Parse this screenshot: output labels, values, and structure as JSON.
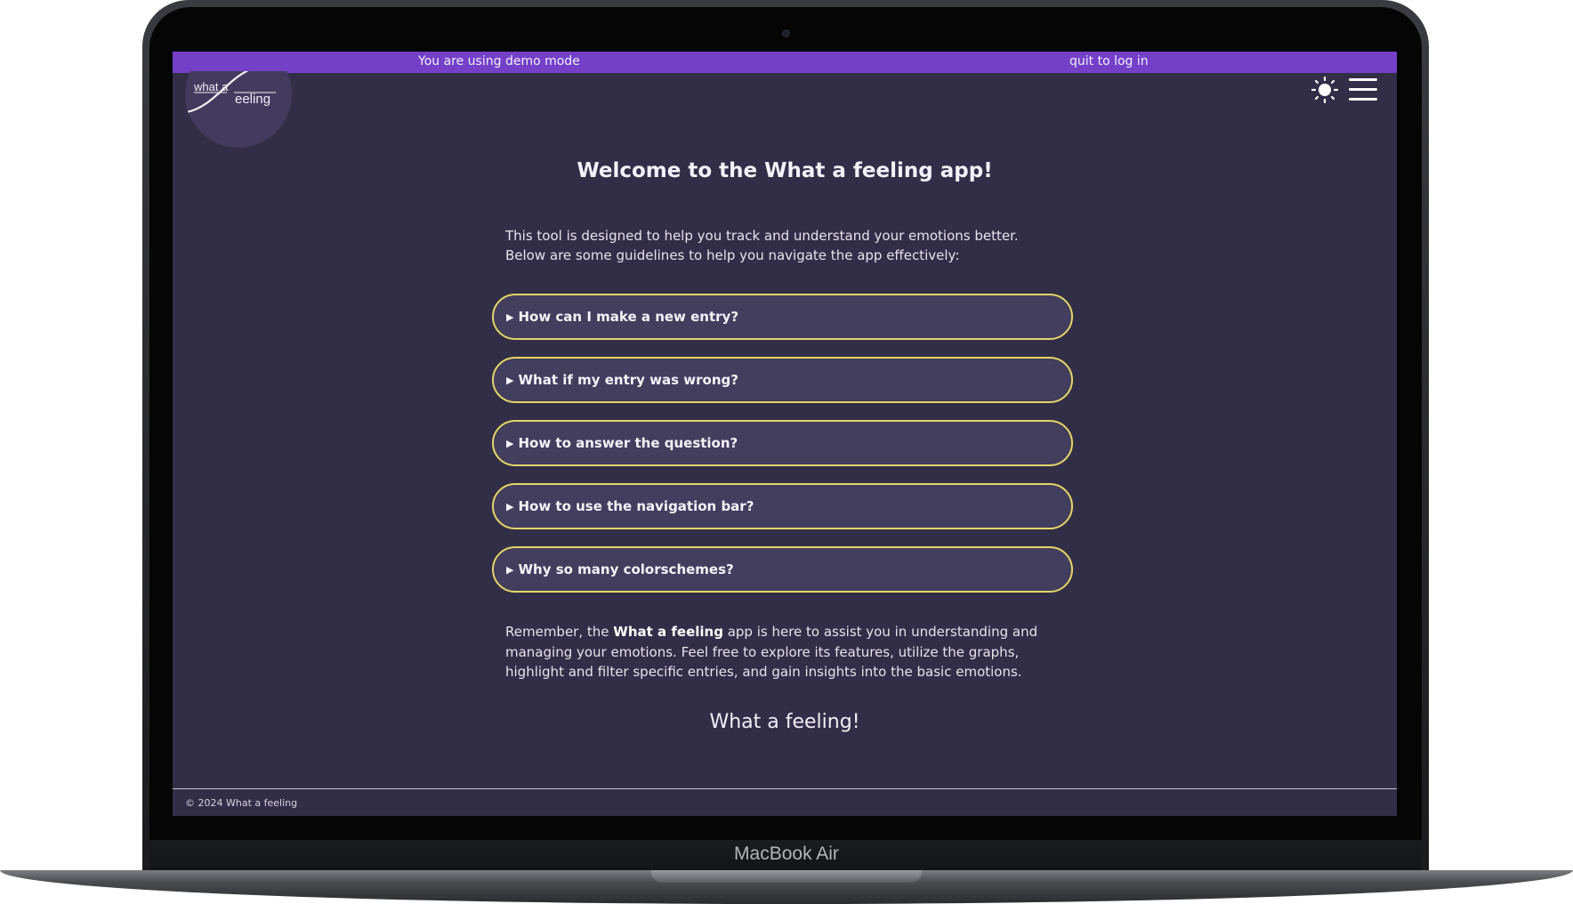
{
  "device": {
    "model_label": "MacBook Air"
  },
  "banner": {
    "demo_text": "You are using demo mode",
    "quit_label": "quit to log in",
    "color": "#7440c8"
  },
  "logo": {
    "line1": "what a",
    "line2": "eeling"
  },
  "header": {
    "theme_icon": "sun-icon",
    "menu_icon": "hamburger-menu-icon"
  },
  "main": {
    "title": "Welcome to the What a feeling app!",
    "intro": "This tool is designed to help you track and understand your emotions better. Below are some guidelines to help you navigate the app effectively:",
    "faq": [
      {
        "question": "How can I make a new entry?"
      },
      {
        "question": "What if my entry was wrong?"
      },
      {
        "question": "How to answer the question?"
      },
      {
        "question": "How to use the navigation bar?"
      },
      {
        "question": "Why so many colorschemes?"
      }
    ],
    "outro_prefix": "Remember, the ",
    "outro_bold": "What a feeling",
    "outro_suffix": " app is here to assist you in understanding and managing your emotions. Feel free to explore its features, utilize the graphs, highlight and filter specific entries, and gain insights into the basic emotions.",
    "closing": "What a feeling!"
  },
  "footer": {
    "text": "© 2024 What a feeling"
  },
  "colors": {
    "background": "#332e47",
    "faq_border": "#e2d766",
    "faq_fill": "#433d5e"
  }
}
